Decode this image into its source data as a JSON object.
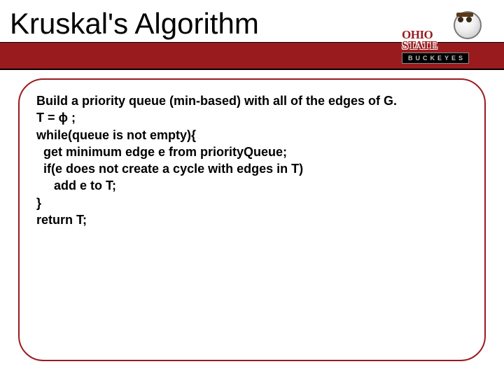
{
  "title": "Kruskal's Algorithm",
  "logo": {
    "line1": "OHIO",
    "line2": "STATE",
    "sub": "BUCKEYES"
  },
  "code": {
    "l1": "Build a priority queue (min-based) with all of the edges of G.",
    "l2": "T = ϕ ;",
    "l3": "while(queue is not empty){",
    "l4": "  get minimum edge e from priorityQueue;",
    "l5": "  if(e does not create a cycle with edges in T)",
    "l6": "     add e to T;",
    "l7": "}",
    "l8": "return T;"
  },
  "colors": {
    "accent": "#9a1b1e"
  }
}
